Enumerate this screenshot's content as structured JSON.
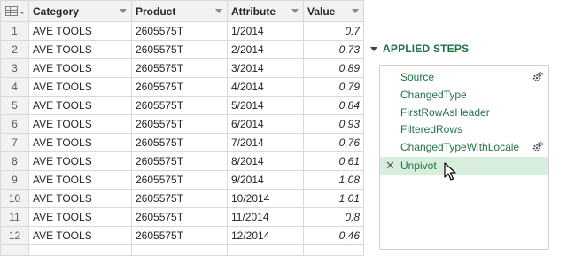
{
  "grid": {
    "columns": [
      "Category",
      "Product",
      "Attribute",
      "Value"
    ],
    "rows": [
      {
        "n": "1",
        "category": "AVE TOOLS",
        "product": "2605575T",
        "attribute": "1/2014",
        "value": "0,7"
      },
      {
        "n": "2",
        "category": "AVE TOOLS",
        "product": "2605575T",
        "attribute": "2/2014",
        "value": "0,73"
      },
      {
        "n": "3",
        "category": "AVE TOOLS",
        "product": "2605575T",
        "attribute": "3/2014",
        "value": "0,89"
      },
      {
        "n": "4",
        "category": "AVE TOOLS",
        "product": "2605575T",
        "attribute": "4/2014",
        "value": "0,79"
      },
      {
        "n": "5",
        "category": "AVE TOOLS",
        "product": "2605575T",
        "attribute": "5/2014",
        "value": "0,84"
      },
      {
        "n": "6",
        "category": "AVE TOOLS",
        "product": "2605575T",
        "attribute": "6/2014",
        "value": "0,93"
      },
      {
        "n": "7",
        "category": "AVE TOOLS",
        "product": "2605575T",
        "attribute": "7/2014",
        "value": "0,76"
      },
      {
        "n": "8",
        "category": "AVE TOOLS",
        "product": "2605575T",
        "attribute": "8/2014",
        "value": "0,61"
      },
      {
        "n": "9",
        "category": "AVE TOOLS",
        "product": "2605575T",
        "attribute": "9/2014",
        "value": "1,08"
      },
      {
        "n": "10",
        "category": "AVE TOOLS",
        "product": "2605575T",
        "attribute": "10/2014",
        "value": "1,01"
      },
      {
        "n": "11",
        "category": "AVE TOOLS",
        "product": "2605575T",
        "attribute": "11/2014",
        "value": "0,8"
      },
      {
        "n": "12",
        "category": "AVE TOOLS",
        "product": "2605575T",
        "attribute": "12/2014",
        "value": "0,46"
      }
    ]
  },
  "applied_steps": {
    "title": "APPLIED STEPS",
    "steps": [
      "Source",
      "ChangedType",
      "FirstRowAsHeader",
      "FilteredRows",
      "ChangedTypeWithLocale",
      "Unpivot"
    ],
    "selected": "Unpivot"
  },
  "colors": {
    "accent": "#217346",
    "selected_bg": "#d8eedd"
  }
}
